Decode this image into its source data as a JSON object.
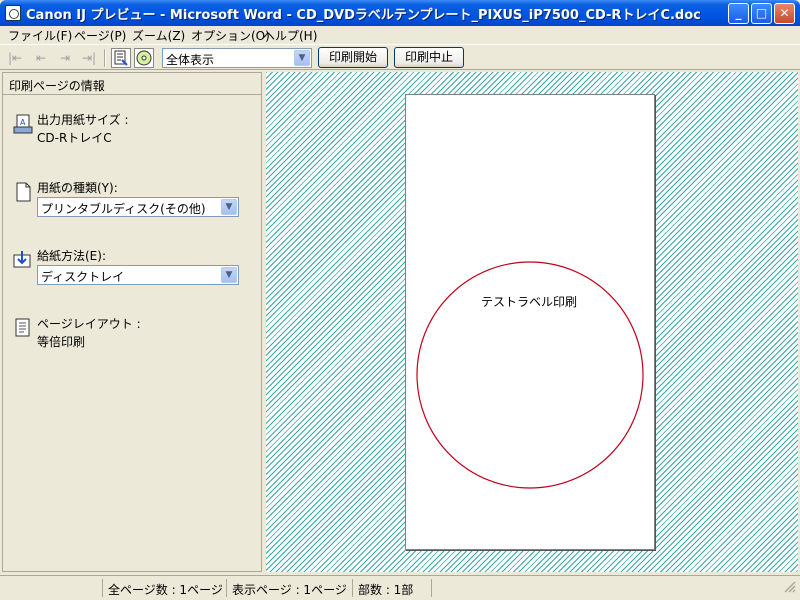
{
  "window": {
    "title": "Canon IJ プレビュー - Microsoft Word - CD_DVDラベルテンプレート_PIXUS_iP7500_CD-RトレイC.doc",
    "minimize": "_",
    "maximize": "□",
    "close": "✕"
  },
  "menu": {
    "file": "ファイル(F)",
    "page": "ページ(P)",
    "zoom": "ズーム(Z)",
    "options": "オプション(O)",
    "help": "ヘルプ(H)"
  },
  "toolbar": {
    "first_icon": "|⇤",
    "prev_icon": "⇤",
    "next_icon": "⇥",
    "last_icon": "⇥|",
    "view_mode": "全体表示",
    "print_start": "印刷開始",
    "print_stop": "印刷中止"
  },
  "left_panel": {
    "header": "印刷ページの情報",
    "output_paper_label": "出力用紙サイズ :",
    "output_paper_value": "CD-RトレイC",
    "media_type_label": "用紙の種類(Y):",
    "media_type_value": "プリンタブルディスク(その他)",
    "paper_source_label": "給紙方法(E):",
    "paper_source_value": "ディスクトレイ",
    "layout_label": "ページレイアウト :",
    "layout_value": "等倍印刷"
  },
  "preview": {
    "label_text": "テストラベル印刷",
    "circle_color": "#c0001a",
    "pattern_color": "#38a9a9"
  },
  "status": {
    "total_pages": "全ページ数 :   1ページ",
    "display_page": "表示ページ :   1ページ",
    "copies": "部数 :   1部"
  }
}
